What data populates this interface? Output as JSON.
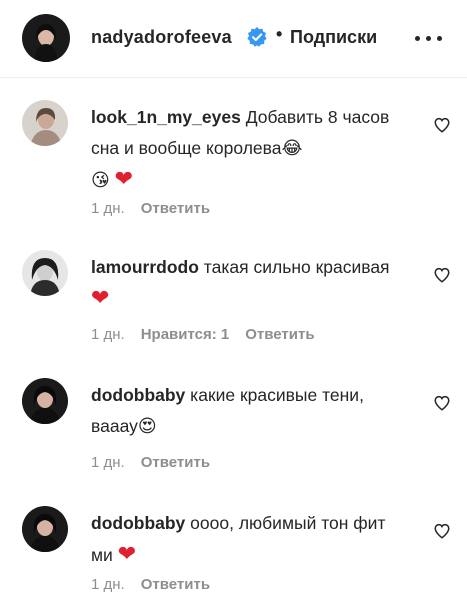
{
  "header": {
    "username": "nadyadorofeeva",
    "separator": "•",
    "follow_label": "Подписки",
    "verified_color": "#3897f0"
  },
  "comments": [
    {
      "username": "look_1n_my_eyes",
      "text": "Добавить 8 часов сна и вообще королева",
      "emojis": [
        "😂",
        "😘",
        "❤"
      ],
      "time": "1 дн.",
      "reply_label": "Ответить"
    },
    {
      "username": "lamourrdodo",
      "text": "такая сильно красивая",
      "emojis": [
        "❤"
      ],
      "time": "1 дн.",
      "likes_label": "Нравится: 1",
      "reply_label": "Ответить"
    },
    {
      "username": "dodobbaby",
      "text": "какие красивые тени, вааау",
      "emojis": [
        "😍"
      ],
      "time": "1 дн.",
      "reply_label": "Ответить"
    },
    {
      "username": "dodobbaby",
      "text": "оооо, любимый тон фит ми",
      "emojis": [
        "❤"
      ],
      "time": "1 дн.",
      "reply_label": "Ответить"
    }
  ],
  "colors": {
    "text": "#262626",
    "secondary": "#8e8e8e",
    "heart": "#e0202e",
    "divider": "#efefef"
  }
}
